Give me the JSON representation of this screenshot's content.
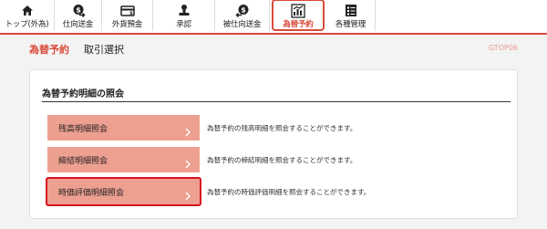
{
  "nav": {
    "tabs": [
      {
        "label": "トップ(外為)",
        "icon": "home-icon"
      },
      {
        "label": "仕向送金",
        "icon": "outgoing-remittance-icon"
      },
      {
        "label": "外貨預金",
        "icon": "foreign-deposit-icon"
      },
      {
        "label": "承認",
        "icon": "approval-icon"
      },
      {
        "label": "被仕向送金",
        "icon": "incoming-remittance-icon"
      },
      {
        "label": "為替予約",
        "icon": "forex-contract-icon"
      },
      {
        "label": "各種管理",
        "icon": "management-icon"
      }
    ],
    "active_tab": "為替予約"
  },
  "header": {
    "title": "為替予約",
    "subtitle": "取引選択",
    "screen_id": "GTOP06"
  },
  "panel": {
    "heading": "為替予約明細の照会",
    "rows": [
      {
        "button": "残高明細照会",
        "description": "為替予約の残高明細を照会することができます。"
      },
      {
        "button": "締結明細照会",
        "description": "為替予約の締結明細を照会することができます。"
      },
      {
        "button": "時価評価明細照会",
        "description": "為替予約の時価評価明細を照会することができます。"
      }
    ]
  },
  "colors": {
    "accent": "#d94a3a",
    "button_fill": "#eea090",
    "highlight_border": "#d6141f"
  }
}
